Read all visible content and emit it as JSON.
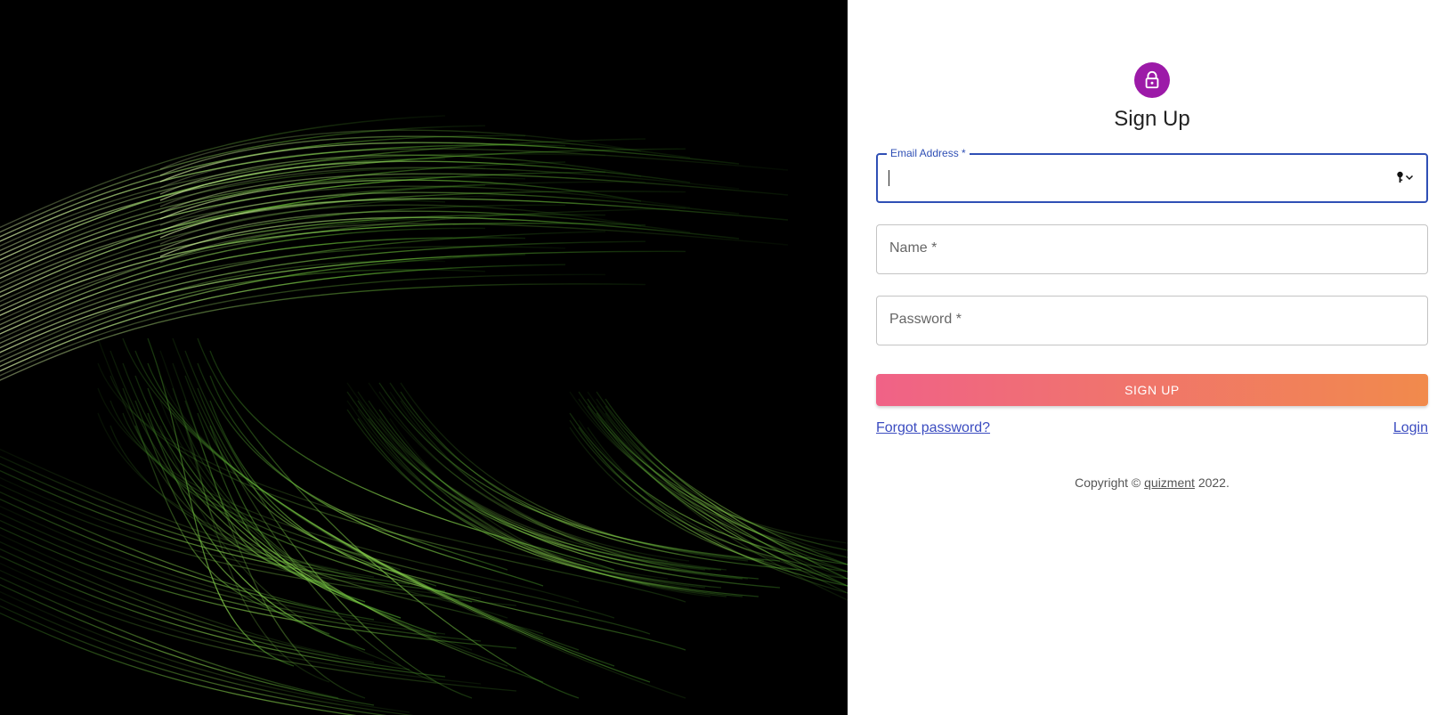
{
  "colors": {
    "avatar_bg": "#9c1aa8",
    "focus": "#2f4fb5",
    "link": "#3b4cc0",
    "button_gradient_start": "#f06287",
    "button_gradient_end": "#f18a4c"
  },
  "icons": {
    "avatar": "lock-icon",
    "email_adornment": "key-icon"
  },
  "form": {
    "title": "Sign Up",
    "email": {
      "label": "Email Address",
      "required_mark": "*",
      "value": ""
    },
    "name": {
      "label": "Name",
      "required_mark": "*",
      "value": ""
    },
    "password": {
      "label": "Password",
      "required_mark": "*",
      "value": ""
    },
    "submit_label": "SIGN UP",
    "forgot_label": "Forgot password?",
    "login_label": "Login"
  },
  "footer": {
    "prefix": "Copyright ©",
    "brand": "quizment",
    "suffix": "2022."
  }
}
